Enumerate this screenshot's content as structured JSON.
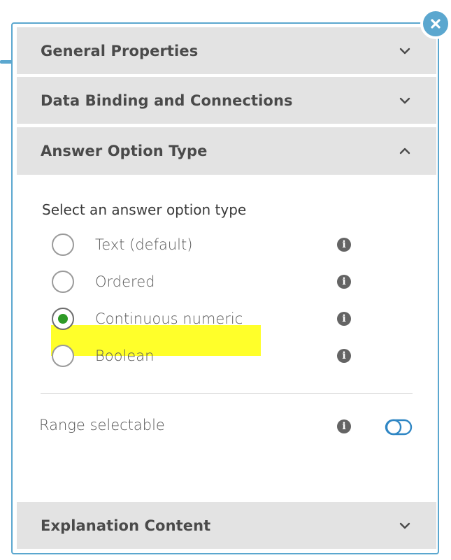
{
  "sections": {
    "general": {
      "title": "General Properties",
      "state": "collapsed"
    },
    "data_binding": {
      "title": "Data Binding and Connections",
      "state": "collapsed"
    },
    "answer_option_type": {
      "title": "Answer Option Type",
      "state": "expanded"
    },
    "explanation": {
      "title": "Explanation Content",
      "state": "collapsed"
    }
  },
  "answer_type": {
    "label": "Select an answer option type",
    "options": [
      {
        "label": "Text (default)",
        "selected": false
      },
      {
        "label": "Ordered",
        "selected": false
      },
      {
        "label": "Continuous numeric",
        "selected": true,
        "highlighted": true
      },
      {
        "label": "Boolean",
        "selected": false
      }
    ]
  },
  "range": {
    "label": "Range selectable",
    "enabled": false
  },
  "colors": {
    "accent": "#5ba7cf",
    "header_bg": "#e3e3e3",
    "selected_radio": "#2e9a26",
    "highlight": "#ffff2a"
  },
  "icons": {
    "close": "close-icon",
    "collapsed": "chevron-down-icon",
    "expanded": "chevron-up-icon",
    "info": "info-icon",
    "toggle": "toggle-off-icon"
  }
}
